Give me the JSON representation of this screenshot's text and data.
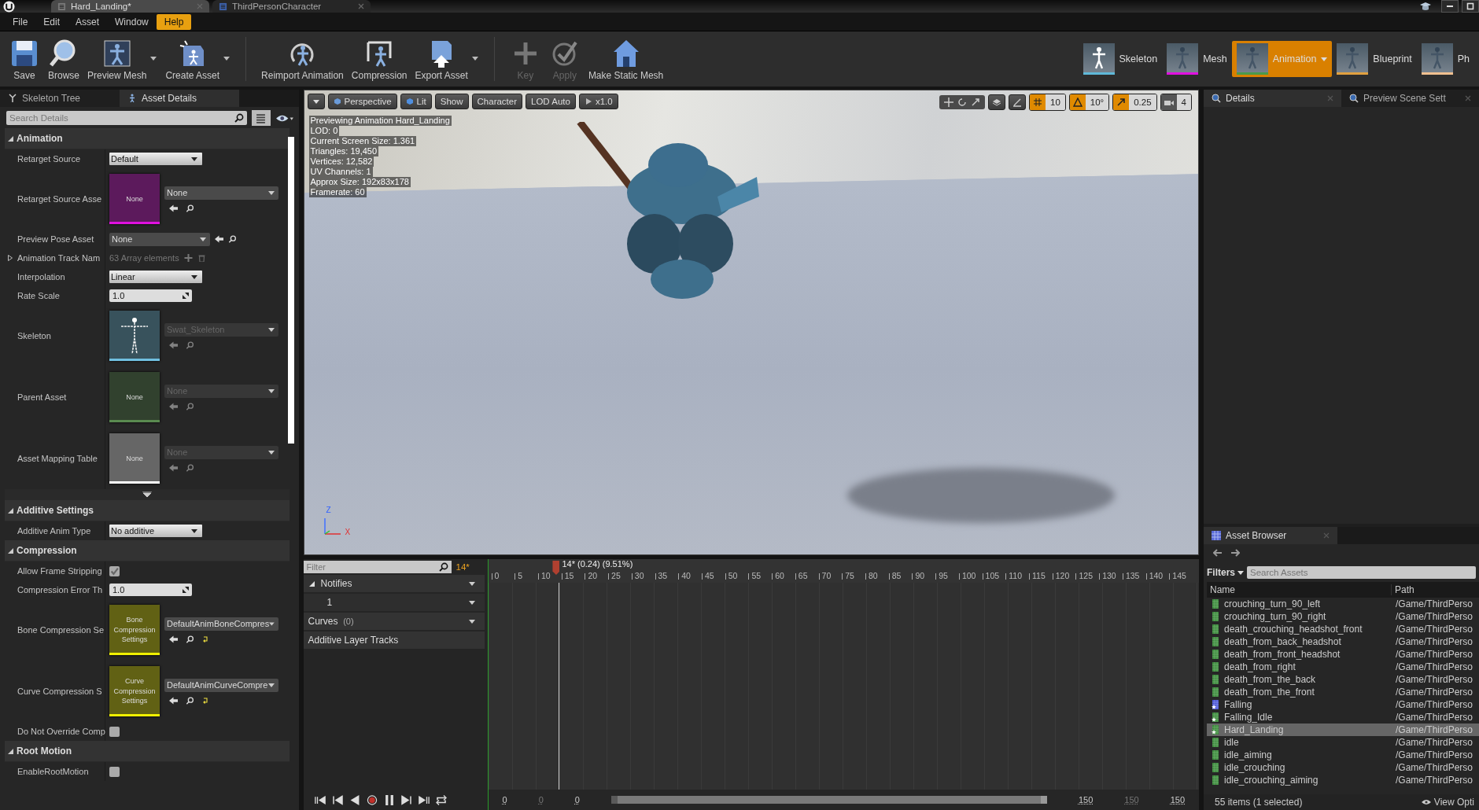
{
  "doc_tabs": [
    {
      "label": "Hard_Landing*",
      "selected": true
    },
    {
      "label": "ThirdPersonCharacter",
      "selected": false
    }
  ],
  "menu": [
    {
      "label": "File",
      "selected": false
    },
    {
      "label": "Edit",
      "selected": false
    },
    {
      "label": "Asset",
      "selected": false
    },
    {
      "label": "Window",
      "selected": false
    },
    {
      "label": "Help",
      "selected": true
    }
  ],
  "toolbar": [
    {
      "label": "Save",
      "kind": "save",
      "disabled": false,
      "dropdown": false
    },
    {
      "label": "Browse",
      "kind": "browse",
      "disabled": false,
      "dropdown": false
    },
    {
      "label": "Preview Mesh",
      "kind": "mesh",
      "disabled": false,
      "dropdown": true
    },
    {
      "label": "Create Asset",
      "kind": "create",
      "disabled": false,
      "dropdown": true
    },
    {
      "label": "Reimport Animation",
      "kind": "reimport",
      "disabled": false,
      "dropdown": false
    },
    {
      "label": "Compression",
      "kind": "compression",
      "disabled": false,
      "dropdown": false
    },
    {
      "label": "Export Asset",
      "kind": "export",
      "disabled": false,
      "dropdown": true
    },
    {
      "label": "Key",
      "kind": "key",
      "disabled": true,
      "dropdown": false
    },
    {
      "label": "Apply",
      "kind": "apply",
      "disabled": true,
      "dropdown": false
    },
    {
      "label": "Make Static Mesh",
      "kind": "static",
      "disabled": false,
      "dropdown": false
    }
  ],
  "modes": [
    {
      "label": "Skeleton",
      "selected": false,
      "color": "#5fb8d8"
    },
    {
      "label": "Mesh",
      "selected": false,
      "color": "#e010e0"
    },
    {
      "label": "Animation",
      "selected": true,
      "color": "#4a9a4a",
      "dropdown": true
    },
    {
      "label": "Blueprint",
      "selected": false,
      "color": "#e0a040"
    },
    {
      "label": "Ph",
      "selected": false,
      "color": "#f0c090"
    }
  ],
  "left_panel": {
    "tabs": [
      {
        "label": "Skeleton Tree",
        "selected": false
      },
      {
        "label": "Asset Details",
        "selected": true
      }
    ],
    "search": {
      "placeholder": "Search Details"
    },
    "sections": [
      {
        "title": "Animation",
        "expanded": true,
        "rows": [
          {
            "label": "Retarget Source",
            "kind": "dropdown",
            "value": "Default"
          },
          {
            "label": "Retarget Source Asse",
            "kind": "asset",
            "thumb": "None",
            "color": "#e010e0",
            "value": "None",
            "disabled": false
          },
          {
            "label": "Preview Pose Asset",
            "kind": "picker",
            "value": "None"
          },
          {
            "label": "Animation Track Nam",
            "kind": "array",
            "value": "63 Array elements",
            "expanded": false
          },
          {
            "label": "Interpolation",
            "kind": "dropdown",
            "value": "Linear"
          },
          {
            "label": "Rate Scale",
            "kind": "number",
            "value": "1.0"
          },
          {
            "label": "Skeleton",
            "kind": "asset",
            "color": "#70c0e0",
            "value": "Swat_Skeleton",
            "disabled": true
          },
          {
            "label": "Parent Asset",
            "kind": "asset",
            "thumb": "None",
            "color": "#5a8a50",
            "value": "None",
            "disabled": true
          },
          {
            "label": "Asset Mapping Table",
            "kind": "asset",
            "thumb": "None",
            "color": "#ffffff",
            "value": "None",
            "disabled": true
          }
        ],
        "more": true
      },
      {
        "title": "Additive Settings",
        "expanded": true,
        "rows": [
          {
            "label": "Additive Anim Type",
            "kind": "dropdown",
            "value": "No additive"
          }
        ]
      },
      {
        "title": "Compression",
        "expanded": true,
        "rows": [
          {
            "label": "Allow Frame Stripping",
            "kind": "checkbox",
            "checked": true
          },
          {
            "label": "Compression Error Th",
            "kind": "number",
            "value": "1.0"
          },
          {
            "label": "Bone Compression Se",
            "kind": "asset",
            "thumb": "Bone Compression Settings",
            "color": "#f0f000",
            "value": "DefaultAnimBoneCompres",
            "disabled": false,
            "reset": true
          },
          {
            "label": "Curve Compression S",
            "kind": "asset",
            "thumb": "Curve Compression Settings",
            "color": "#f0f000",
            "value": "DefaultAnimCurveCompre",
            "disabled": false,
            "reset": true
          },
          {
            "label": "Do Not Override Comp",
            "kind": "checkbox",
            "checked": false
          }
        ]
      },
      {
        "title": "Root Motion",
        "expanded": true,
        "rows": [
          {
            "label": "EnableRootMotion",
            "kind": "checkbox",
            "checked": false
          }
        ]
      }
    ]
  },
  "viewport": {
    "buttons": [
      "Perspective",
      "Lit",
      "Show",
      "Character",
      "LOD Auto",
      "x1.0"
    ],
    "snaps": [
      {
        "kind": "grid",
        "value": "10",
        "on": true
      },
      {
        "kind": "angle",
        "value": "10°",
        "on": true
      },
      {
        "kind": "scale",
        "value": "0.25",
        "on": true
      },
      {
        "kind": "camera",
        "value": "4",
        "on": false
      }
    ],
    "stats": [
      "Previewing Animation Hard_Landing",
      "LOD: 0",
      "Current Screen Size: 1.361",
      "Triangles: 19,450",
      "Vertices: 12,582",
      "UV Channels: 1",
      "Approx Size: 192x83x178",
      "Framerate: 60"
    ],
    "axes": [
      "Z",
      "X"
    ]
  },
  "timeline": {
    "filter": {
      "placeholder": "Filter"
    },
    "frame": "14*",
    "tracks": [
      {
        "label": "Notifies",
        "kind": "group",
        "expanded": true
      },
      {
        "label": "1",
        "kind": "track"
      },
      {
        "label": "Curves",
        "kind": "group",
        "count": "(0)"
      },
      {
        "label": "Additive Layer Tracks",
        "kind": "plain"
      }
    ],
    "ruler": [
      "0",
      "5",
      "10",
      "15",
      "20",
      "25",
      "30",
      "35",
      "40",
      "45",
      "50",
      "55",
      "60",
      "65",
      "70",
      "75",
      "80",
      "85",
      "90",
      "95",
      "100",
      "105",
      "110",
      "115",
      "120",
      "125",
      "130",
      "135",
      "140",
      "145"
    ],
    "playhead": {
      "label": "14* (0.24) (9.51%)",
      "level": 0.0951
    },
    "range_start": [
      "0",
      "0",
      "0"
    ],
    "range_end": [
      "150",
      "150",
      "150"
    ]
  },
  "right_panel": {
    "tabs": [
      {
        "label": "Details",
        "selected": true
      },
      {
        "label": "Preview Scene Sett",
        "selected": false
      }
    ],
    "asset_browser": {
      "title": "Asset Browser",
      "filters": "Filters",
      "search": {
        "placeholder": "Search Assets"
      },
      "columns": [
        "Name",
        "Path"
      ],
      "rows": [
        {
          "name": "crouching_turn_90_left",
          "path": "/Game/ThirdPerso",
          "kind": "sequence",
          "starred": false,
          "selected": false
        },
        {
          "name": "crouching_turn_90_right",
          "path": "/Game/ThirdPerso",
          "kind": "sequence",
          "starred": false,
          "selected": false
        },
        {
          "name": "death_crouching_headshot_front",
          "path": "/Game/ThirdPerso",
          "kind": "sequence",
          "starred": false,
          "selected": false
        },
        {
          "name": "death_from_back_headshot",
          "path": "/Game/ThirdPerso",
          "kind": "sequence",
          "starred": false,
          "selected": false
        },
        {
          "name": "death_from_front_headshot",
          "path": "/Game/ThirdPerso",
          "kind": "sequence",
          "starred": false,
          "selected": false
        },
        {
          "name": "death_from_right",
          "path": "/Game/ThirdPerso",
          "kind": "sequence",
          "starred": false,
          "selected": false
        },
        {
          "name": "death_from_the_back",
          "path": "/Game/ThirdPerso",
          "kind": "sequence",
          "starred": false,
          "selected": false
        },
        {
          "name": "death_from_the_front",
          "path": "/Game/ThirdPerso",
          "kind": "sequence",
          "starred": false,
          "selected": false
        },
        {
          "name": "Falling",
          "path": "/Game/ThirdPerso",
          "kind": "blendspace",
          "starred": true,
          "selected": false
        },
        {
          "name": "Falling_Idle",
          "path": "/Game/ThirdPerso",
          "kind": "sequence",
          "starred": true,
          "selected": false
        },
        {
          "name": "Hard_Landing",
          "path": "/Game/ThirdPerso",
          "kind": "sequence",
          "starred": true,
          "selected": true
        },
        {
          "name": "idle",
          "path": "/Game/ThirdPerso",
          "kind": "sequence",
          "starred": false,
          "selected": false
        },
        {
          "name": "idle_aiming",
          "path": "/Game/ThirdPerso",
          "kind": "sequence",
          "starred": false,
          "selected": false
        },
        {
          "name": "idle_crouching",
          "path": "/Game/ThirdPerso",
          "kind": "sequence",
          "starred": false,
          "selected": false
        },
        {
          "name": "idle_crouching_aiming",
          "path": "/Game/ThirdPerso",
          "kind": "sequence",
          "starred": false,
          "selected": false
        }
      ],
      "status": "55 items (1 selected)",
      "view_options": "View Opti"
    }
  }
}
